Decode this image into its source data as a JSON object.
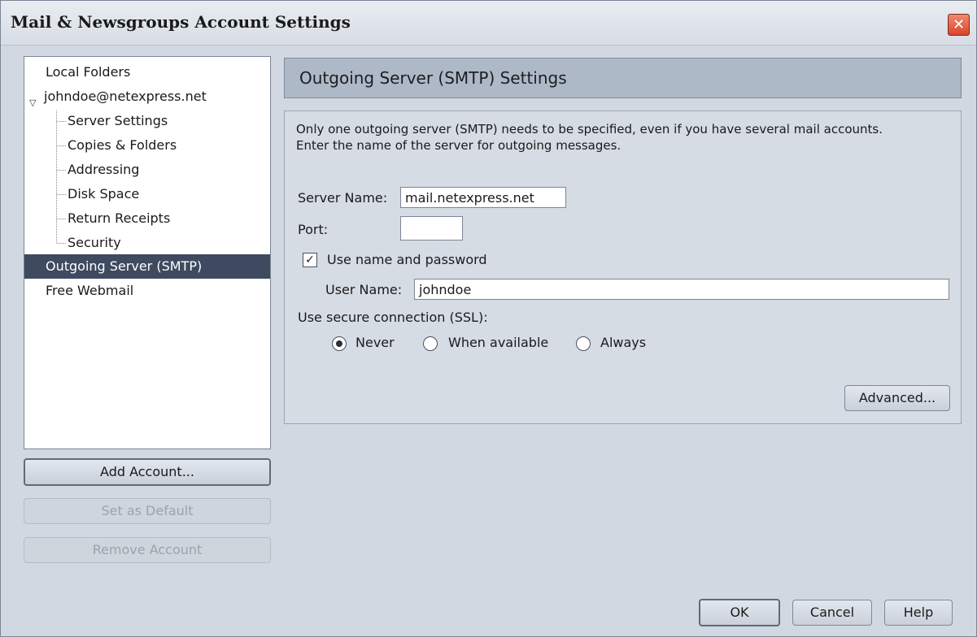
{
  "window": {
    "title": "Mail & Newsgroups Account Settings",
    "close_symbol": "✕"
  },
  "tree": {
    "items": [
      {
        "label": "Local Folders"
      },
      {
        "label": "johndoe@netexpress.net",
        "expander": "▽"
      },
      {
        "label": "Server Settings"
      },
      {
        "label": "Copies & Folders"
      },
      {
        "label": "Addressing"
      },
      {
        "label": "Disk Space"
      },
      {
        "label": "Return Receipts"
      },
      {
        "label": "Security"
      },
      {
        "label": "Outgoing Server (SMTP)",
        "selected": true
      },
      {
        "label": "Free Webmail"
      }
    ]
  },
  "left_buttons": {
    "add_account": "Add Account...",
    "set_default": "Set as Default",
    "remove_account": "Remove Account"
  },
  "panel": {
    "header": "Outgoing Server (SMTP) Settings",
    "description_line1": "Only one outgoing server (SMTP) needs to be specified, even if you have several mail accounts.",
    "description_line2": "Enter the name of the server for outgoing messages.",
    "server_name_label": "Server Name:",
    "server_name_value": "mail.netexpress.net",
    "port_label": "Port:",
    "port_value": "",
    "use_auth_label": "Use name and password",
    "use_auth_checked": true,
    "check_mark": "✓",
    "user_name_label": "User Name:",
    "user_name_value": "johndoe",
    "ssl_label": "Use secure connection (SSL):",
    "ssl_options": [
      {
        "label": "Never",
        "selected": true
      },
      {
        "label": "When available",
        "selected": false
      },
      {
        "label": "Always",
        "selected": false
      }
    ],
    "advanced_button": "Advanced..."
  },
  "footer": {
    "ok": "OK",
    "cancel": "Cancel",
    "help": "Help"
  },
  "colors": {
    "selection": "#3e4a5f",
    "header_bg": "#aeb9c7",
    "window_bg": "#d2d8e1"
  }
}
